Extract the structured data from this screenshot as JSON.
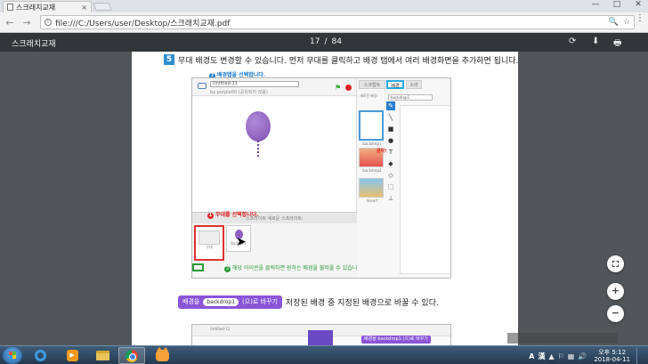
{
  "browser": {
    "tab_title": "스크래치교재",
    "tab_close": "×",
    "url": "file:///C:/Users/user/Desktop/스크래치교재.pdf",
    "nav": {
      "back": "←",
      "forward": "→",
      "reload": "C"
    },
    "win": {
      "minimize": "—",
      "maximize": "□",
      "close": "✕"
    },
    "omni_icons": {
      "zoom": "🔍",
      "star": "☆"
    },
    "menu": "⋮"
  },
  "pdf_viewer": {
    "title": "스크래치교재",
    "current_page": "17",
    "page_separator": "/",
    "total_pages": "84",
    "icons": {
      "rotate": "⟳",
      "download": "⬇",
      "print": "🖶"
    }
  },
  "document": {
    "step_number": "5",
    "step_text": "무대 배경도 변경할 수 있습니다. 먼저 무대를 클릭하고 배경 탭에서 여러 배경화면을 추가하면 됩니다.",
    "figure": {
      "project_name": "Untitled-11",
      "project_by": "by purple00 (공유되지 않음)",
      "sprites_header": "스프라이트     새로운 스프라이트:",
      "callout_1": "무대를 선택합니다.",
      "callout_1_num": "1",
      "callout_2": "배경탭을 선택합니다.",
      "callout_2_num": "2",
      "callout_3": "해당 아이콘을 클릭하면 원하는 배경을 불러올 수 있습니다.",
      "callout_3_num": "3",
      "click_label": "클릭!",
      "tabs": [
        "스크립트",
        "배경",
        "소리"
      ],
      "new_backdrop": "새로운 배경:",
      "backdrop_name": "backdrop1",
      "stage_label": "무대",
      "sprite_label": "Balloon1",
      "backdrops": [
        "backdrop1",
        "backdrop2",
        "desert"
      ]
    },
    "block": {
      "prefix": "배경을",
      "dropdown": "backdrop1",
      "suffix": "(으)로 바꾸기"
    },
    "block_description": "저장된 배경 중 지정된 배경으로 바꿀 수 있다.",
    "figure2": {
      "header": "Untitled-11",
      "block_text": "배경을 backdrop1 (으)로 바꾸기"
    },
    "ghost_tooltip": "     "
  },
  "zoom_controls": {
    "fit": "",
    "zoom_in": "+",
    "zoom_out": "−"
  },
  "taskbar": {
    "ime_label": "A",
    "ime_mode": "漢",
    "time": "오후 5:12",
    "date": "2018-04-11",
    "apps": [
      "ie-icon",
      "media-icon",
      "folder-icon",
      "chrome-icon",
      "scratch-icon"
    ]
  },
  "colors": {
    "pdf_toolbar": "#323639",
    "viewer_bg": "#525659",
    "scratch_looks_block": "#8a55d7",
    "callout_red": "#d22",
    "callout_blue": "#1878c7",
    "callout_green": "#2a9b3a"
  }
}
